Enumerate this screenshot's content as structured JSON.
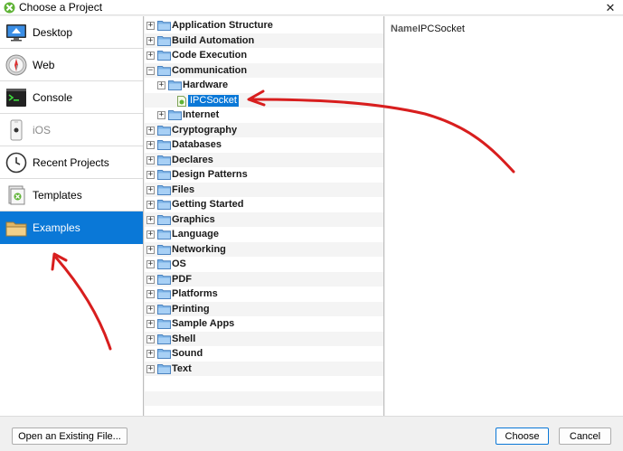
{
  "window": {
    "title": "Choose a Project",
    "app_icon": "app-logo-icon",
    "close_glyph": "✕"
  },
  "categories": [
    {
      "label": "Desktop",
      "icon": "desktop-icon",
      "selected": false,
      "disabled": false
    },
    {
      "label": "Web",
      "icon": "web-icon",
      "selected": false,
      "disabled": false
    },
    {
      "label": "Console",
      "icon": "console-icon",
      "selected": false,
      "disabled": false
    },
    {
      "label": "iOS",
      "icon": "ios-icon",
      "selected": false,
      "disabled": true
    },
    {
      "label": "Recent Projects",
      "icon": "clock-icon",
      "selected": false,
      "disabled": false
    },
    {
      "label": "Templates",
      "icon": "templates-icon",
      "selected": false,
      "disabled": false
    },
    {
      "label": "Examples",
      "icon": "folder-icon",
      "selected": true,
      "disabled": false
    }
  ],
  "tree": [
    {
      "label": "Application Structure",
      "level": 0,
      "expander": "+",
      "type": "folder"
    },
    {
      "label": "Build Automation",
      "level": 0,
      "expander": "+",
      "type": "folder"
    },
    {
      "label": "Code Execution",
      "level": 0,
      "expander": "+",
      "type": "folder"
    },
    {
      "label": "Communication",
      "level": 0,
      "expander": "−",
      "type": "folder"
    },
    {
      "label": "Hardware",
      "level": 1,
      "expander": "+",
      "type": "folder"
    },
    {
      "label": "IPCSocket",
      "level": 1,
      "expander": "",
      "type": "project",
      "selected": true
    },
    {
      "label": "Internet",
      "level": 1,
      "expander": "+",
      "type": "folder"
    },
    {
      "label": "Cryptography",
      "level": 0,
      "expander": "+",
      "type": "folder"
    },
    {
      "label": "Databases",
      "level": 0,
      "expander": "+",
      "type": "folder"
    },
    {
      "label": "Declares",
      "level": 0,
      "expander": "+",
      "type": "folder"
    },
    {
      "label": "Design Patterns",
      "level": 0,
      "expander": "+",
      "type": "folder"
    },
    {
      "label": "Files",
      "level": 0,
      "expander": "+",
      "type": "folder"
    },
    {
      "label": "Getting Started",
      "level": 0,
      "expander": "+",
      "type": "folder"
    },
    {
      "label": "Graphics",
      "level": 0,
      "expander": "+",
      "type": "folder"
    },
    {
      "label": "Language",
      "level": 0,
      "expander": "+",
      "type": "folder"
    },
    {
      "label": "Networking",
      "level": 0,
      "expander": "+",
      "type": "folder"
    },
    {
      "label": "OS",
      "level": 0,
      "expander": "+",
      "type": "folder"
    },
    {
      "label": "PDF",
      "level": 0,
      "expander": "+",
      "type": "folder"
    },
    {
      "label": "Platforms",
      "level": 0,
      "expander": "+",
      "type": "folder"
    },
    {
      "label": "Printing",
      "level": 0,
      "expander": "+",
      "type": "folder"
    },
    {
      "label": "Sample Apps",
      "level": 0,
      "expander": "+",
      "type": "folder"
    },
    {
      "label": "Shell",
      "level": 0,
      "expander": "+",
      "type": "folder"
    },
    {
      "label": "Sound",
      "level": 0,
      "expander": "+",
      "type": "folder"
    },
    {
      "label": "Text",
      "level": 0,
      "expander": "+",
      "type": "folder"
    }
  ],
  "details": {
    "name_key": "Name",
    "name_value": "IPCSocket"
  },
  "buttons": {
    "open": "Open an Existing File...",
    "choose": "Choose",
    "cancel": "Cancel"
  },
  "colors": {
    "selection": "#0a78d7",
    "folder": "#7cb3e6",
    "annotation": "#d81e1e"
  }
}
